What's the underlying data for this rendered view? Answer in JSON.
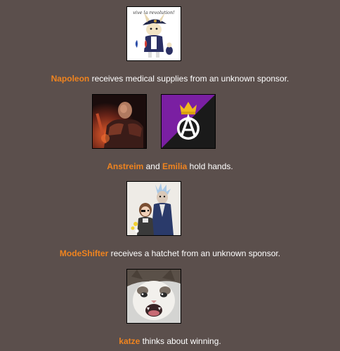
{
  "events": [
    {
      "tributes": [
        {
          "name": "Napoleon",
          "avatar_caption": "vive la revolution!"
        }
      ],
      "text_after": " receives medical supplies from an unknown sponsor."
    },
    {
      "tributes": [
        {
          "name": "Anstreim"
        },
        {
          "name": "Emilia"
        }
      ],
      "joiner": " and ",
      "text_after": " hold hands."
    },
    {
      "tributes": [
        {
          "name": "ModeShifter"
        }
      ],
      "text_after": " receives a hatchet from an unknown sponsor."
    },
    {
      "tributes": [
        {
          "name": "katze"
        }
      ],
      "text_after": " thinks about winning."
    }
  ],
  "colors": {
    "background": "#5b4f4c",
    "tribute_name": "#f0841f",
    "text": "#ffffff"
  },
  "icons": {
    "avatar_1": "napoleon-cartoon-avatar",
    "avatar_2": "armored-warrior-avatar",
    "avatar_3": "anarchist-crown-flag-avatar",
    "avatar_4": "cartoon-scientist-avatar",
    "avatar_5": "crying-cat-avatar"
  }
}
